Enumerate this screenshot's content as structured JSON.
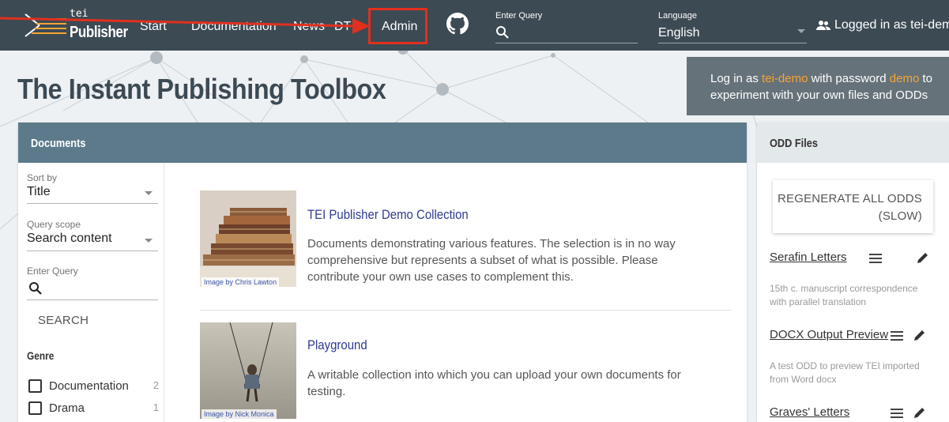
{
  "topbar": {
    "logo_small": "tei",
    "logo_main": "Publisher",
    "nav": {
      "start": "Start",
      "documentation": "Documentation",
      "news": "News",
      "dts": "DT",
      "admin": "Admin"
    },
    "query_label": "Enter Query",
    "language_label": "Language",
    "language_value": "English",
    "logged_in": "Logged in as tei-demo"
  },
  "headline": "The Instant Publishing Toolbox",
  "login_hint": {
    "prefix": "Log in as ",
    "user": "tei-demo",
    "middle": " with password ",
    "password": "demo",
    "suffix": " to experiment with your own files and ODDs"
  },
  "documents": {
    "title": "Documents",
    "sort_label": "Sort by",
    "sort_value": "Title",
    "scope_label": "Query scope",
    "scope_value": "Search content",
    "query_label": "Enter Query",
    "search_button": "SEARCH",
    "genre_title": "Genre",
    "genres": [
      {
        "name": "Documentation",
        "count": "2"
      },
      {
        "name": "Drama",
        "count": "1"
      }
    ],
    "items": [
      {
        "title": "TEI Publisher Demo Collection",
        "description": "Documents demonstrating various features. The selection is in no way comprehensive but represents a subset of what is possible. Please contribute your own use cases to complement this.",
        "credit_prefix": "Image by",
        "credit_name": "Chris Lawton"
      },
      {
        "title": "Playground",
        "description": "A writable collection into which you can upload your own documents for testing.",
        "credit_prefix": "Image by",
        "credit_name": "Nick Monica"
      }
    ]
  },
  "odd": {
    "title": "ODD Files",
    "regenerate_button": "REGENERATE ALL ODDS (SLOW)",
    "items": [
      {
        "name": "Serafin Letters",
        "description": "15th c. manuscript correspondence with parallel translation"
      },
      {
        "name": "DOCX Output Preview",
        "description": "A test ODD to preview TEI imported from Word docx"
      },
      {
        "name": "Graves' Letters",
        "description": ""
      }
    ]
  },
  "colors": {
    "topbar": "#3c4a54",
    "docs_header": "#5c7a8a",
    "highlight": "#f6a431",
    "annotation_red": "#e0301e",
    "link": "#2f3a8f"
  }
}
